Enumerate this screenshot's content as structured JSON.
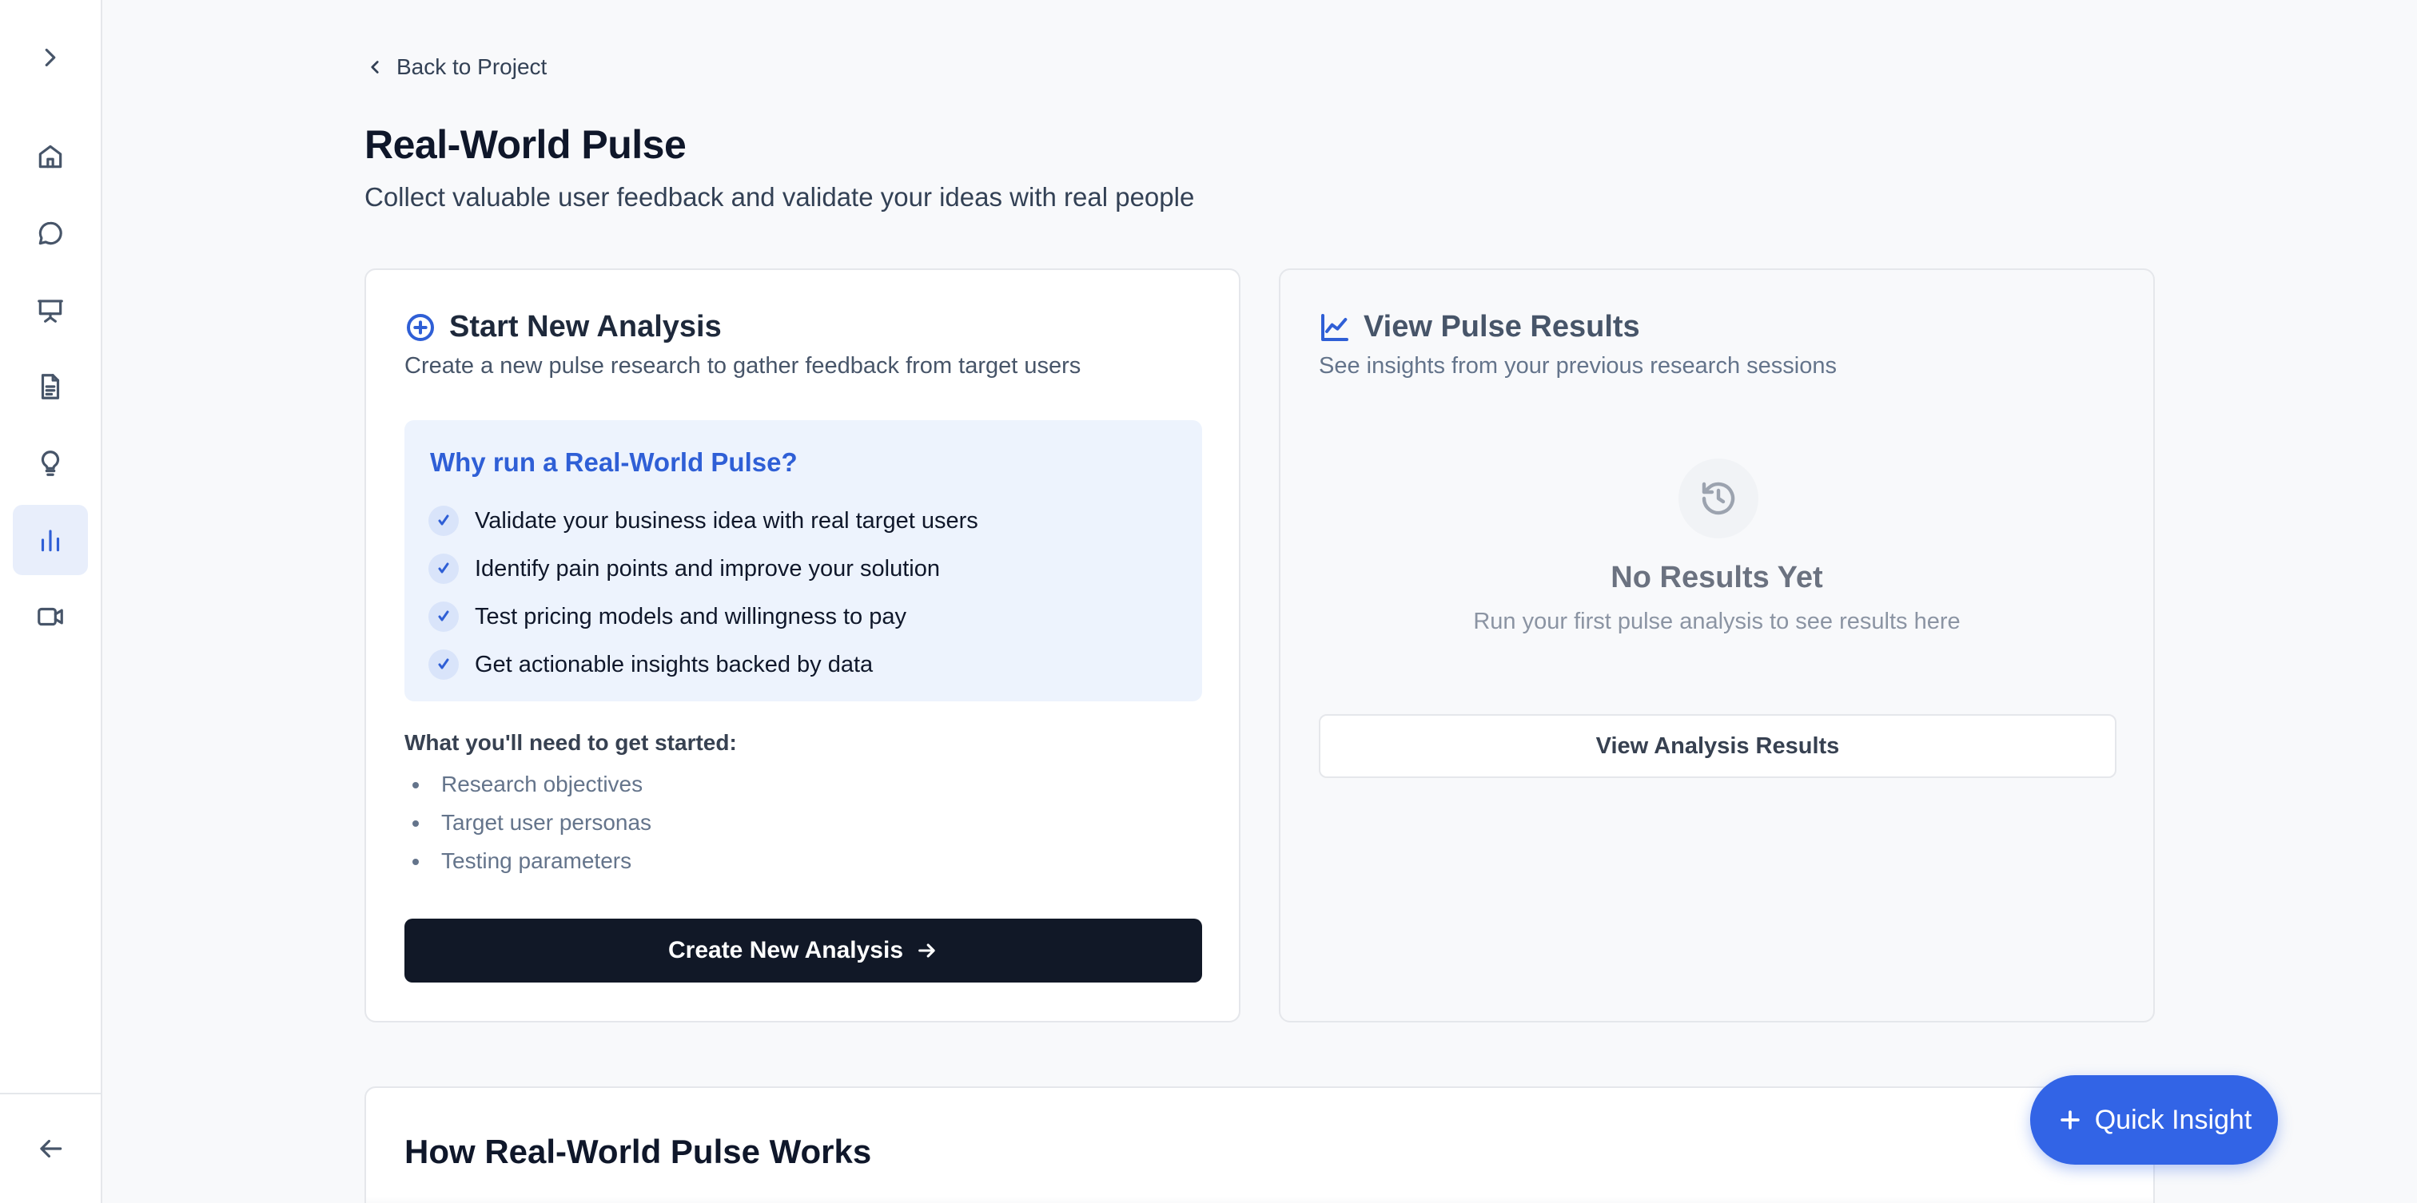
{
  "back_link": "Back to Project",
  "page": {
    "title": "Real-World Pulse",
    "subtitle": "Collect valuable user feedback and validate your ideas with real people"
  },
  "start_card": {
    "title": "Start New Analysis",
    "description": "Create a new pulse research to gather feedback from target users",
    "why_title": "Why run a Real-World Pulse?",
    "benefits": [
      "Validate your business idea with real target users",
      "Identify pain points and improve your solution",
      "Test pricing models and willingness to pay",
      "Get actionable insights backed by data"
    ],
    "need_title": "What you'll need to get started:",
    "needs": [
      "Research objectives",
      "Target user personas",
      "Testing parameters"
    ],
    "button_label": "Create New Analysis"
  },
  "results_card": {
    "title": "View Pulse Results",
    "description": "See insights from your previous research sessions",
    "empty_title": "No Results Yet",
    "empty_description": "Run your first pulse analysis to see results here",
    "button_label": "View Analysis Results"
  },
  "how_section": {
    "title": "How Real-World Pulse Works"
  },
  "fab": {
    "label": "Quick Insight"
  },
  "sidebar": {
    "items": [
      {
        "icon": "chevron-right-icon"
      },
      {
        "icon": "home-icon"
      },
      {
        "icon": "chat-icon"
      },
      {
        "icon": "presentation-icon"
      },
      {
        "icon": "document-icon"
      },
      {
        "icon": "lightbulb-icon"
      },
      {
        "icon": "bar-chart-icon",
        "active": true
      },
      {
        "icon": "video-icon"
      },
      {
        "icon": "arrow-left-icon"
      }
    ]
  },
  "colors": {
    "accent": "#2f5fd6",
    "primary_button": "#111827",
    "fab": "#3264e6",
    "highlight_bg": "#edf3fd"
  }
}
